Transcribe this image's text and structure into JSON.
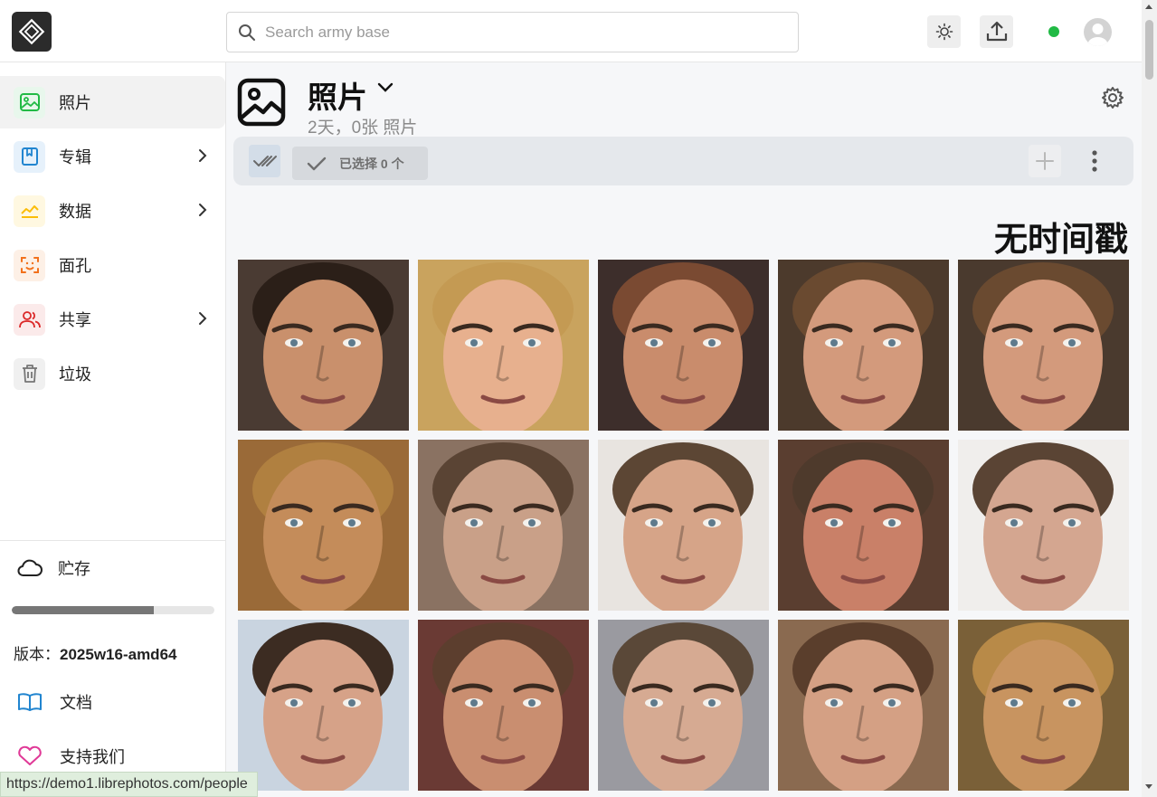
{
  "search": {
    "placeholder": "Search army base"
  },
  "sidebar": {
    "items": [
      {
        "label": "照片",
        "icon": "image-icon",
        "color": "#21ba45",
        "bg": "#e8f7ec",
        "active": true,
        "has_submenu": false
      },
      {
        "label": "专辑",
        "icon": "album-icon",
        "color": "#2185d0",
        "bg": "#e6f1fb",
        "active": false,
        "has_submenu": true
      },
      {
        "label": "数据",
        "icon": "chart-area-icon",
        "color": "#fbbd08",
        "bg": "#fff8e1",
        "active": false,
        "has_submenu": true
      },
      {
        "label": "面孔",
        "icon": "face-scan-icon",
        "color": "#f2711c",
        "bg": "#fdf0e6",
        "active": false,
        "has_submenu": false
      },
      {
        "label": "共享",
        "icon": "users-icon",
        "color": "#db2828",
        "bg": "#fbeaea",
        "active": false,
        "has_submenu": true
      },
      {
        "label": "垃圾",
        "icon": "trash-icon",
        "color": "#767676",
        "bg": "#f0f0f0",
        "active": false,
        "has_submenu": false
      }
    ],
    "storage_label": "贮存",
    "storage_used_fraction": 0.7,
    "version_prefix": "版本：",
    "version_value": "2025w16-amd64",
    "docs_label": "文档",
    "support_label": "支持我们"
  },
  "header": {
    "title": "照片",
    "subtitle": "2天，0张 照片"
  },
  "toolbar": {
    "selected_label": "已选择 0 个"
  },
  "group": {
    "title": "无时间戳"
  },
  "photos": [
    {
      "bg": "#4a3b33",
      "skin": "#c9906c",
      "hair": "#2b1f18"
    },
    {
      "bg": "#c9a35e",
      "skin": "#e7b08e",
      "hair": "#c49a53"
    },
    {
      "bg": "#3d2e2b",
      "skin": "#c98c6c",
      "hair": "#7a4a32"
    },
    {
      "bg": "#4c3a2c",
      "skin": "#d39a7c",
      "hair": "#6a4a30"
    },
    {
      "bg": "#4a3a2e",
      "skin": "#d39a7c",
      "hair": "#6a4a30"
    },
    {
      "bg": "#9a6a38",
      "skin": "#c48c5a",
      "hair": "#b08040"
    },
    {
      "bg": "#8a7262",
      "skin": "#c9a088",
      "hair": "#5a4434"
    },
    {
      "bg": "#e8e4e0",
      "skin": "#d6a488",
      "hair": "#5c4634"
    },
    {
      "bg": "#5a3e30",
      "skin": "#c98068",
      "hair": "#4e3a2c"
    },
    {
      "bg": "#f0eeec",
      "skin": "#d4a690",
      "hair": "#5a4434"
    },
    {
      "bg": "#c9d4e0",
      "skin": "#d6a288",
      "hair": "#3c2c22"
    },
    {
      "bg": "#6a3a34",
      "skin": "#c98e70",
      "hair": "#5c3e2e"
    },
    {
      "bg": "#9a9aa0",
      "skin": "#d6aa92",
      "hair": "#5a4838"
    },
    {
      "bg": "#8a6a50",
      "skin": "#d4a084",
      "hair": "#5a3e2c"
    },
    {
      "bg": "#7a6038",
      "skin": "#c89460",
      "hair": "#b88a48"
    }
  ],
  "status": {
    "url": "https://demo1.librephotos.com/people"
  }
}
